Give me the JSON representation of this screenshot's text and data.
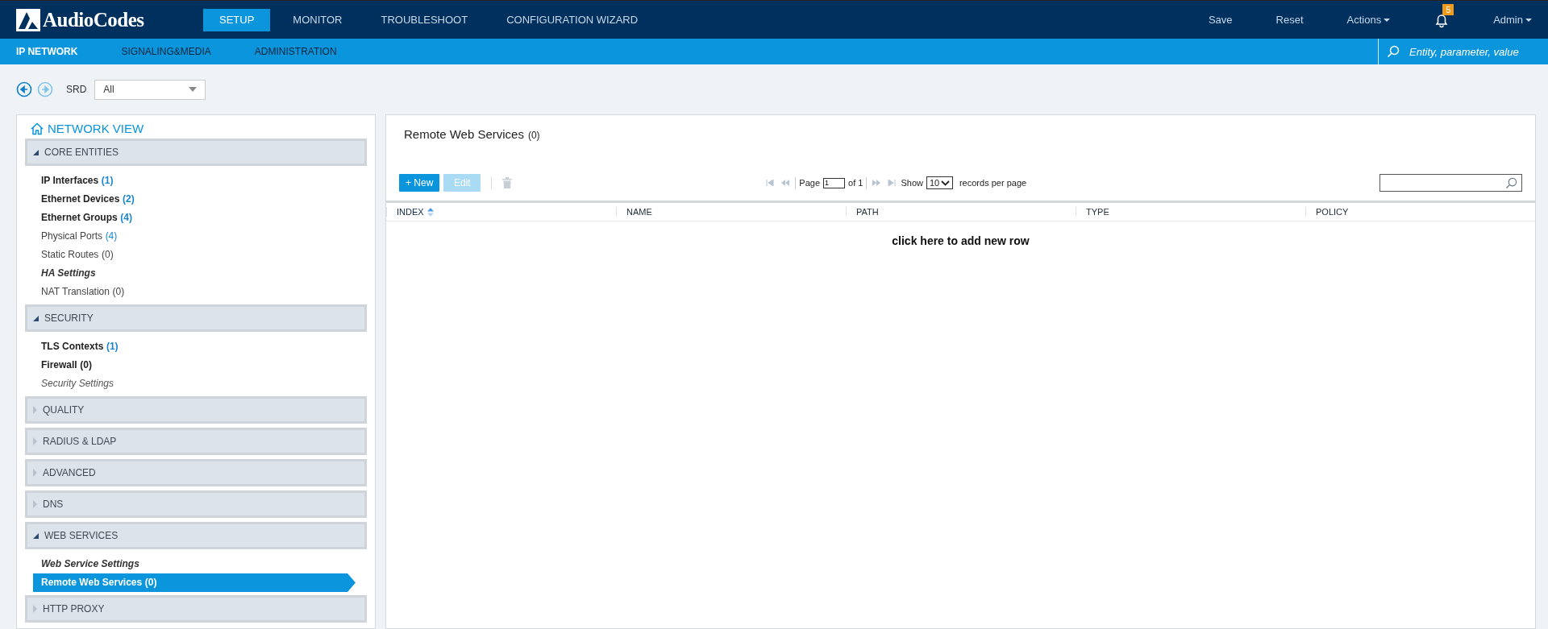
{
  "header": {
    "logo": "AudioCodes",
    "tabs": [
      {
        "label": "SETUP",
        "selected": true
      },
      {
        "label": "MONITOR",
        "selected": false
      },
      {
        "label": "TROUBLESHOOT",
        "selected": false
      },
      {
        "label": "CONFIGURATION WIZARD",
        "selected": false
      }
    ],
    "actions": [
      {
        "label": "Save",
        "dropdown": false
      },
      {
        "label": "Reset",
        "dropdown": false
      },
      {
        "label": "Actions",
        "dropdown": true
      }
    ],
    "notifications": {
      "count": "5"
    },
    "user": {
      "label": "Admin",
      "dropdown": true
    }
  },
  "subnav": {
    "tabs": [
      {
        "label": "IP NETWORK",
        "selected": true
      },
      {
        "label": "SIGNALING&MEDIA",
        "selected": false
      },
      {
        "label": "ADMINISTRATION",
        "selected": false
      }
    ],
    "search": {
      "placeholder": "Entity, parameter, value"
    }
  },
  "filter": {
    "back_disabled": false,
    "forward_disabled": true,
    "label": "SRD",
    "value": "All"
  },
  "network_view": {
    "title": "NETWORK VIEW",
    "sections": [
      {
        "title": "CORE ENTITIES",
        "expanded": true,
        "items": [
          {
            "label": "IP Interfaces",
            "count": "(1)",
            "kind": "bold",
            "count_highlighted": true,
            "selected": false
          },
          {
            "label": "Ethernet Devices",
            "count": "(2)",
            "kind": "bold",
            "count_highlighted": true,
            "selected": false
          },
          {
            "label": "Ethernet Groups",
            "count": "(4)",
            "kind": "bold",
            "count_highlighted": true,
            "selected": false
          },
          {
            "label": "Physical Ports",
            "count": "(4)",
            "kind": "plain",
            "count_highlighted": true,
            "selected": false
          },
          {
            "label": "Static Routes",
            "count": "(0)",
            "kind": "plain",
            "count_highlighted": false,
            "selected": false
          },
          {
            "label": "HA Settings",
            "kind": "bold-italic",
            "selected": false
          },
          {
            "label": "NAT Translation",
            "count": "(0)",
            "kind": "plain",
            "count_highlighted": false,
            "selected": false
          }
        ]
      },
      {
        "title": "SECURITY",
        "expanded": true,
        "items": [
          {
            "label": "TLS Contexts",
            "count": "(1)",
            "kind": "bold",
            "count_highlighted": true,
            "selected": false
          },
          {
            "label": "Firewall",
            "count": "(0)",
            "kind": "bold",
            "count_highlighted": false,
            "selected": false
          },
          {
            "label": "Security Settings",
            "kind": "italic",
            "selected": false
          }
        ]
      },
      {
        "title": "QUALITY",
        "expanded": false
      },
      {
        "title": "RADIUS & LDAP",
        "expanded": false
      },
      {
        "title": "ADVANCED",
        "expanded": false
      },
      {
        "title": "DNS",
        "expanded": false
      },
      {
        "title": "WEB SERVICES",
        "expanded": true,
        "items": [
          {
            "label": "Web Service Settings",
            "kind": "bold-italic",
            "selected": false
          },
          {
            "label": "Remote Web Services",
            "count": "(0)",
            "kind": "bold",
            "count_highlighted": false,
            "selected": true
          }
        ]
      },
      {
        "title": "HTTP PROXY",
        "expanded": false
      }
    ]
  },
  "main": {
    "title": "Remote Web Services",
    "count": "(0)",
    "toolbar": {
      "buttons": [
        {
          "label": "+ New",
          "disabled": false
        },
        {
          "label": "Edit",
          "disabled": true
        }
      ],
      "delete_disabled": true
    },
    "pager": {
      "page_label": "Page",
      "page": "1",
      "of": "of 1",
      "show_label": "Show",
      "per_page": "10",
      "suffix": "records per page"
    },
    "table": {
      "columns": [
        {
          "label": "INDEX",
          "sorted": true
        },
        {
          "label": "NAME",
          "sorted": false
        },
        {
          "label": "PATH",
          "sorted": false
        },
        {
          "label": "TYPE",
          "sorted": false
        },
        {
          "label": "POLICY",
          "sorted": false
        }
      ],
      "empty_text": "click here to add new row"
    }
  }
}
